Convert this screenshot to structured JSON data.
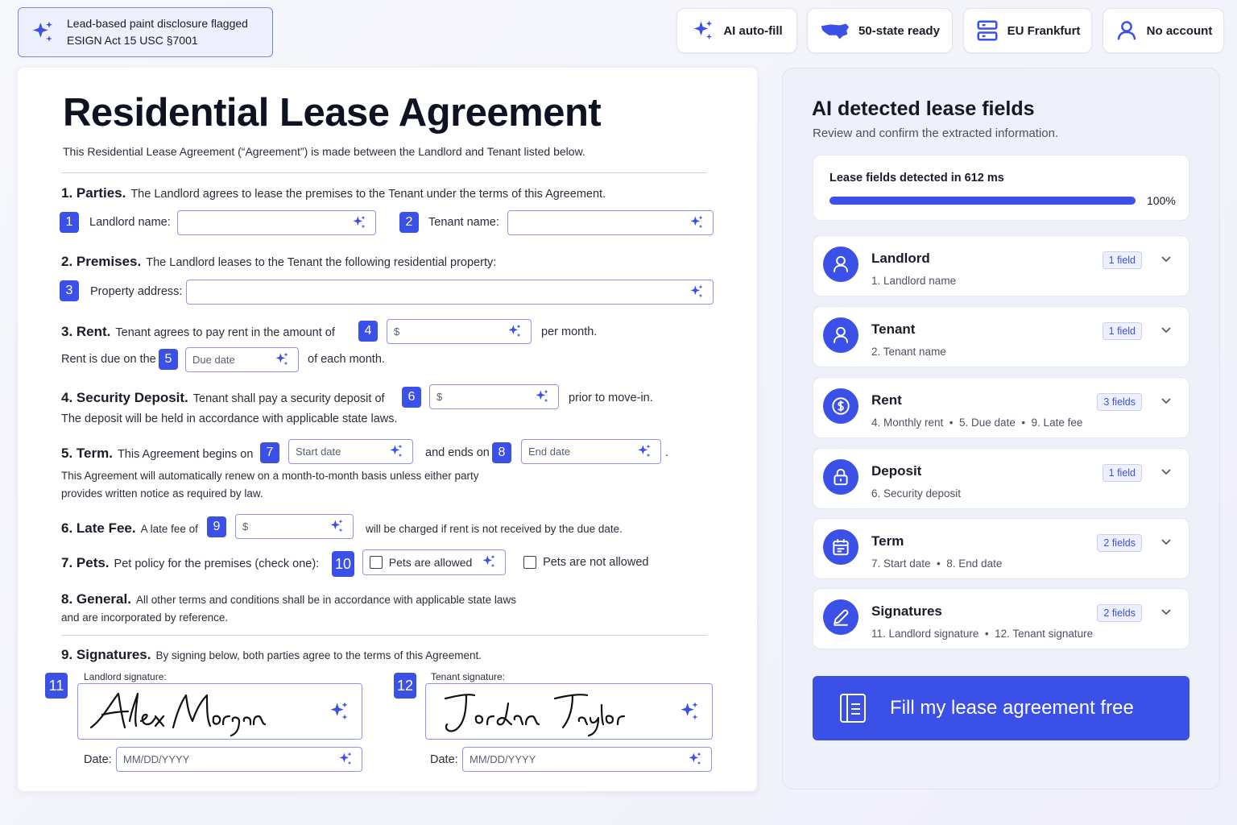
{
  "notice": {
    "line1": "Lead-based paint disclosure flagged",
    "line2": "ESIGN Act 15 USC §7001"
  },
  "pills": [
    {
      "icon": "sparkle-icon",
      "label": "AI auto-fill"
    },
    {
      "icon": "usa-map-icon",
      "label": "50-state ready"
    },
    {
      "icon": "server-icon",
      "label": "EU Frankfurt"
    },
    {
      "icon": "user-icon",
      "label": "No account"
    }
  ],
  "doc": {
    "title": "Residential Lease Agreement",
    "intro": "This Residential Lease Agreement (“Agreement”) is made between the Landlord and Tenant listed below.",
    "s1": {
      "heading": "1. Parties.",
      "text": "The Landlord agrees to lease the premises to the Tenant under the terms of this Agreement.",
      "landlord_label": "Landlord name:",
      "tenant_label": "Tenant name:"
    },
    "s2": {
      "heading": "2. Premises.",
      "text": "The Landlord leases to the Tenant the following residential property:",
      "address_label": "Property address:"
    },
    "s3": {
      "heading": "3. Rent.",
      "text": "Tenant agrees to pay rent in the amount of",
      "after": "per month.",
      "line2_pre": "Rent is due on the",
      "line2_post": "of each month.",
      "rent_value": "$",
      "due_placeholder": "Due date"
    },
    "s4": {
      "heading": "4. Security Deposit.",
      "text": "Tenant shall pay a security deposit of",
      "after": "prior to move-in.",
      "line2": "The deposit will be held in accordance with applicable state laws.",
      "value": "$"
    },
    "s5": {
      "heading": "5. Term.",
      "text": "This Agreement begins on",
      "mid": "and ends on",
      "end": ".",
      "start_placeholder": "Start date",
      "end_placeholder": "End date",
      "line2": "This Agreement will automatically renew on a month-to-month basis unless either party",
      "line3": "provides written notice as required by law."
    },
    "s6": {
      "heading": "6. Late Fee.",
      "text": "A late fee of",
      "after": "will be charged if rent is not received by the due date.",
      "value": "$"
    },
    "s7": {
      "heading": "7. Pets.",
      "text": "Pet policy for the premises (check one):",
      "opt1": "Pets are allowed",
      "opt2": "Pets are not allowed"
    },
    "s8": {
      "heading": "8. General.",
      "text": "All other terms and conditions shall be in accordance with applicable state laws",
      "line2": "and are incorporated by reference."
    },
    "s9": {
      "heading": "9. Signatures.",
      "text": "By signing below, both parties agree to the terms of this Agreement.",
      "landlord_sig_label": "Landlord signature:",
      "tenant_sig_label": "Tenant signature:",
      "landlord_sig": "Alex Morgan",
      "tenant_sig": "Jordan Taylor",
      "date_label": "Date:",
      "date_placeholder": "MM/DD/YYYY"
    },
    "numbers": [
      "1",
      "2",
      "3",
      "4",
      "5",
      "6",
      "7",
      "8",
      "9",
      "10",
      "11",
      "12"
    ]
  },
  "panel": {
    "title": "AI detected lease fields",
    "subtitle": "Review and confirm the extracted information.",
    "progress": {
      "label": "Lease fields detected in 612 ms",
      "percent": 100,
      "percent_label": "100%"
    },
    "groups": [
      {
        "name": "Landlord",
        "fields": "1. Landlord name",
        "badge": "1 field",
        "icon": "user-icon"
      },
      {
        "name": "Tenant",
        "fields": "2. Tenant name",
        "badge": "1 field",
        "icon": "user-icon"
      },
      {
        "name": "Rent",
        "fields": "4. Monthly rent  •  5. Due date  •  9. Late fee",
        "badge": "3 fields",
        "icon": "dollar-icon"
      },
      {
        "name": "Deposit",
        "fields": "6. Security deposit",
        "badge": "1 field",
        "icon": "lock-icon"
      },
      {
        "name": "Term",
        "fields": "7. Start date  •  8. End date",
        "badge": "2 fields",
        "icon": "calendar-icon"
      },
      {
        "name": "Signatures",
        "fields": "11. Landlord signature  •  12. Tenant signature",
        "badge": "2 fields",
        "icon": "pen-icon"
      }
    ],
    "cta": "Fill my lease agreement free"
  },
  "colors": {
    "accent": "#3b50e6",
    "field_border": "#8d96ea",
    "panel_bg": "#eef0fa"
  }
}
